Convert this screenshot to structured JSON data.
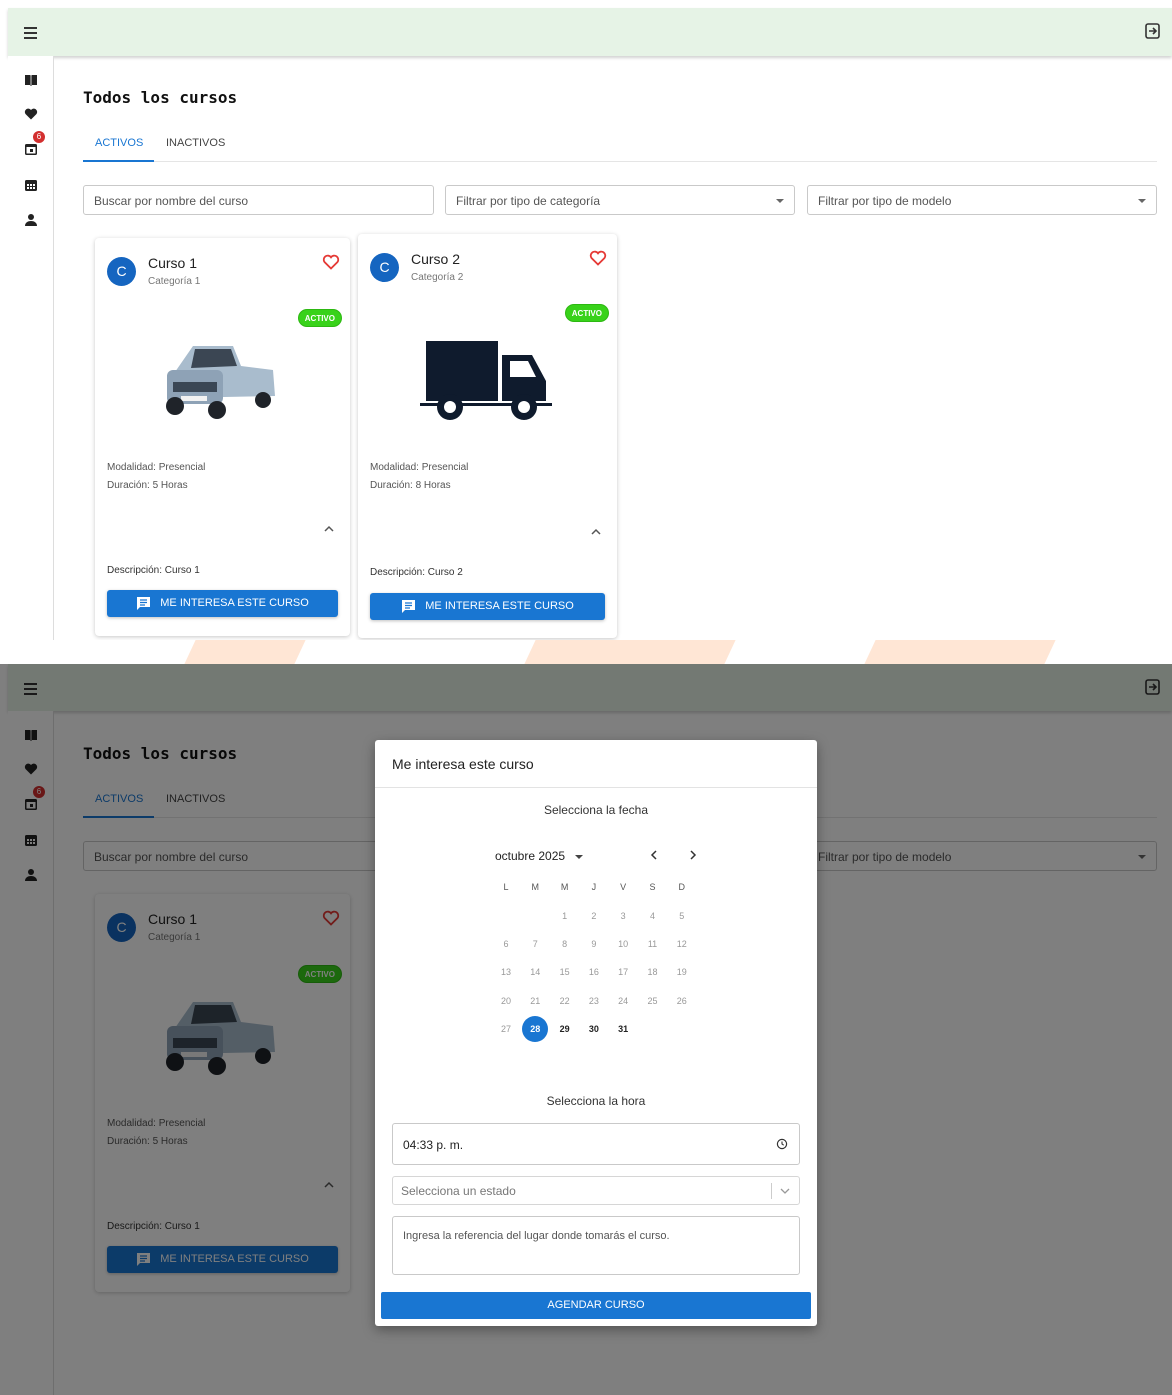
{
  "header": {
    "menu_icon": "hamburger-menu-icon",
    "logout_icon": "logout-icon"
  },
  "sidebar": {
    "items": [
      {
        "icon": "book-icon"
      },
      {
        "icon": "heart-icon"
      },
      {
        "icon": "calendar-check-icon",
        "badge": "6"
      },
      {
        "icon": "calendar-icon"
      },
      {
        "icon": "person-icon"
      }
    ]
  },
  "page": {
    "title": "Todos los cursos"
  },
  "tabs": [
    {
      "label": "ACTIVOS"
    },
    {
      "label": "INACTIVOS"
    }
  ],
  "filters": {
    "search_placeholder": "Buscar por nombre del curso",
    "category_placeholder": "Filtrar por tipo de categoría",
    "model_placeholder": "Filtrar por tipo de modelo"
  },
  "courses": [
    {
      "avatar": "C",
      "title": "Curso 1",
      "category": "Categoría 1",
      "status": "ACTIVO",
      "image": "pickup-truck-image",
      "modality": "Modalidad: Presencial",
      "duration": "Duración: 5 Horas",
      "description": "Descripción: Curso 1",
      "cta": "ME INTERESA ESTE CURSO"
    },
    {
      "avatar": "C",
      "title": "Curso 2",
      "category": "Categoría 2",
      "status": "ACTIVO",
      "image": "box-truck-icon",
      "modality": "Modalidad: Presencial",
      "duration": "Duración: 8 Horas",
      "description": "Descripción: Curso 2",
      "cta": "ME INTERESA ESTE CURSO"
    }
  ],
  "modal": {
    "title": "Me interesa este curso",
    "date_label": "Selecciona la fecha",
    "calendar": {
      "month_label": "octubre 2025",
      "weekdays": [
        "L",
        "M",
        "M",
        "J",
        "V",
        "S",
        "D"
      ],
      "selected_day": "28",
      "enabled_days": [
        "29",
        "30",
        "31"
      ],
      "weeks": [
        [
          "",
          "",
          "1",
          "2",
          "3",
          "4",
          "5"
        ],
        [
          "6",
          "7",
          "8",
          "9",
          "10",
          "11",
          "12"
        ],
        [
          "13",
          "14",
          "15",
          "16",
          "17",
          "18",
          "19"
        ],
        [
          "20",
          "21",
          "22",
          "23",
          "24",
          "25",
          "26"
        ],
        [
          "27",
          "28",
          "29",
          "30",
          "31",
          "",
          ""
        ]
      ]
    },
    "time_label": "Selecciona la hora",
    "time_value": "04:33 p. m.",
    "state_placeholder": "Selecciona un estado",
    "place_placeholder": "Ingresa la referencia del lugar donde tomarás el curso.",
    "submit_label": "AGENDAR CURSO"
  },
  "colors": {
    "primary": "#1976d2",
    "active_badge": "#38d21a",
    "header_bg": "#e6f3e6",
    "heart": "#e53935",
    "notification": "#d32f2f"
  }
}
